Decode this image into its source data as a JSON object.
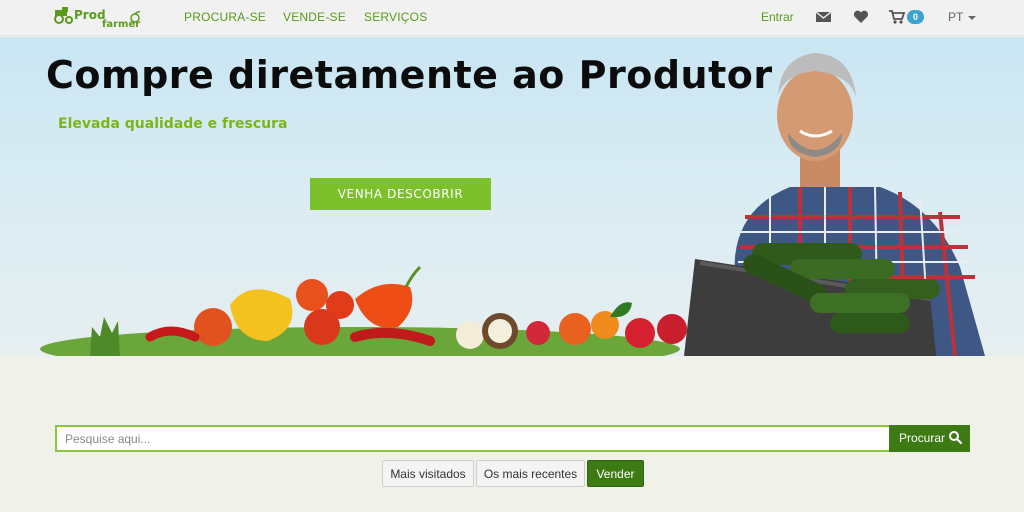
{
  "navbar": {
    "logo_text_1": "Prod",
    "logo_text_2": "farmer",
    "links": [
      "PROCURA-SE",
      "VENDE-SE",
      "SERVIÇOS"
    ],
    "login": "Entrar",
    "cart_count": "0",
    "language": "PT"
  },
  "hero": {
    "title": "Compre diretamente ao Produtor",
    "subtitle": "Elevada qualidade e frescura",
    "cta": "VENHA DESCOBRIR"
  },
  "search": {
    "placeholder": "Pesquise aqui...",
    "button": "Procurar"
  },
  "filters": [
    "Mais visitados",
    "Os mais recentes",
    "Vender"
  ],
  "colors": {
    "brand_green": "#7cc02c",
    "dark_green": "#3d7a13",
    "badge_blue": "#3aa3d0"
  },
  "icons": [
    "envelope-icon",
    "heart-icon",
    "cart-icon",
    "caret-down-icon",
    "search-icon",
    "tractor-icon"
  ]
}
